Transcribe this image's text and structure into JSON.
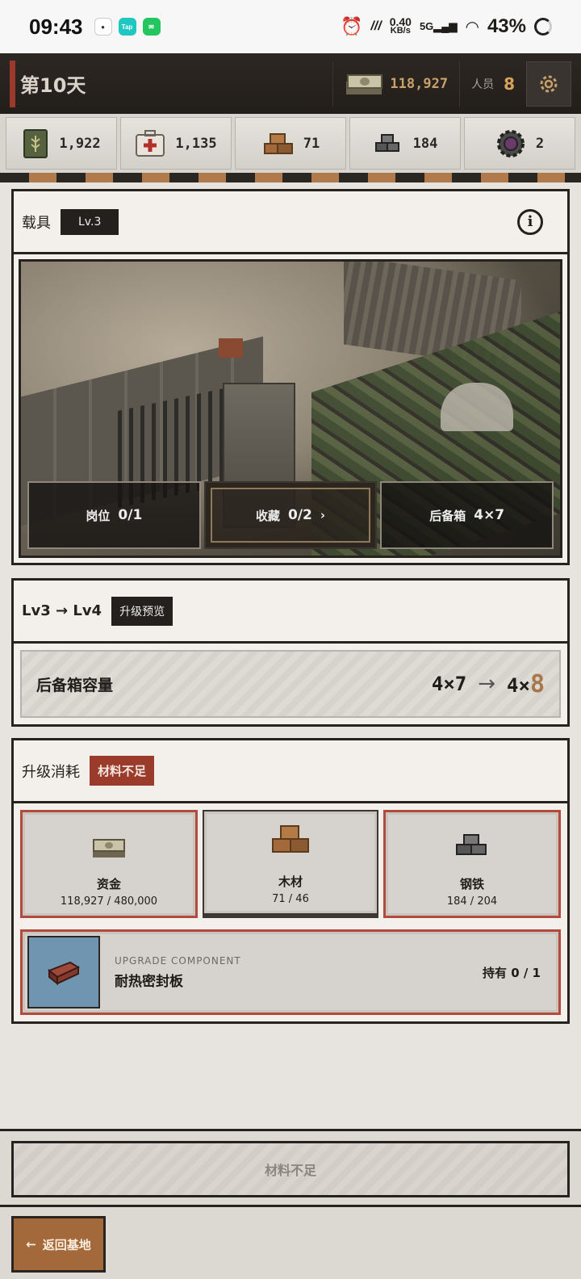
{
  "status_bar": {
    "time": "09:43",
    "speed_value": "0.40",
    "speed_unit": "KB/s",
    "network": "5G",
    "battery": "43%",
    "app_tap": "Tap"
  },
  "header": {
    "day_title": "第10天",
    "money": "118,927",
    "people_label": "人员",
    "people_count": "8"
  },
  "resources": [
    {
      "icon": "food-can-icon",
      "value": "1,922"
    },
    {
      "icon": "medkit-icon",
      "value": "1,135"
    },
    {
      "icon": "wood-icon",
      "value": "71"
    },
    {
      "icon": "steel-icon",
      "value": "184"
    },
    {
      "icon": "gear-part-icon",
      "value": "2"
    }
  ],
  "vehicle_panel": {
    "title": "载具",
    "level": "Lv.3",
    "slots": [
      {
        "label": "岗位",
        "value": "0/1"
      },
      {
        "label": "收藏",
        "value": "0/2",
        "chevron": "›"
      },
      {
        "label": "后备箱",
        "value": "4×7"
      }
    ]
  },
  "upgrade_panel": {
    "from_to": "Lv3 → Lv4",
    "preview_label": "升级预览",
    "stat_name": "后备箱容量",
    "stat_from": "4×7",
    "arrow": "→",
    "stat_to_prefix": "4×",
    "stat_to_highlight": "8"
  },
  "cost_panel": {
    "title": "升级消耗",
    "warning": "材料不足",
    "costs": [
      {
        "name": "资金",
        "amount": "118,927 / 480,000",
        "sufficient": false
      },
      {
        "name": "木材",
        "amount": "71 / 46",
        "sufficient": true
      },
      {
        "name": "钢铁",
        "amount": "184 / 204",
        "sufficient": false
      }
    ],
    "component": {
      "subtitle": "UPGRADE COMPONENT",
      "name": "耐热密封板",
      "owned": "持有 0 / 1"
    }
  },
  "actions": {
    "upgrade_button": "材料不足",
    "back_button": "返回基地",
    "back_arrow": "←"
  },
  "colors": {
    "accent_red": "#9a3b2c",
    "accent_gold": "#c9a06a",
    "accent_orange": "#a4693a"
  }
}
